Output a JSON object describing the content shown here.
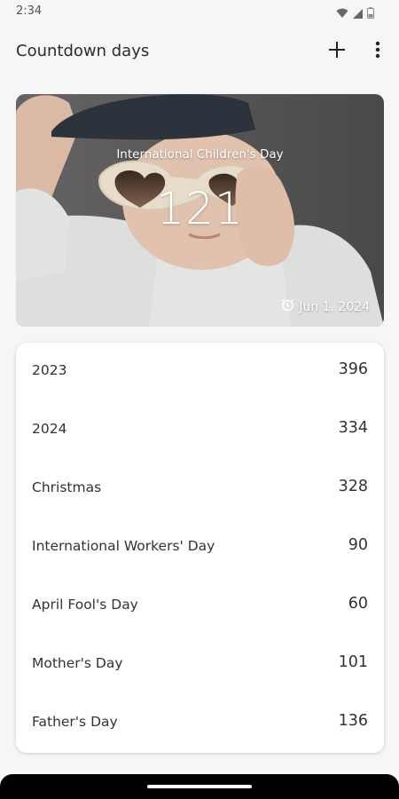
{
  "status_bar": {
    "time": "2:34",
    "icons": [
      "wifi-icon",
      "cellular-signal-icon",
      "battery-icon"
    ]
  },
  "app_bar": {
    "title": "Countdown days",
    "actions": [
      "add-icon",
      "more-vertical-icon"
    ]
  },
  "featured": {
    "name": "International Children's Day",
    "days": "121",
    "date": "Jun 1, 2024",
    "date_icon": "alarm-clock-icon"
  },
  "events": [
    {
      "name": "2023",
      "days": "396"
    },
    {
      "name": "2024",
      "days": "334"
    },
    {
      "name": "Christmas",
      "days": "328"
    },
    {
      "name": "International Workers' Day",
      "days": "90"
    },
    {
      "name": "April Fool's Day",
      "days": "60"
    },
    {
      "name": "Mother's Day",
      "days": "101"
    },
    {
      "name": "Father's Day",
      "days": "136"
    }
  ],
  "colors": {
    "background": "#f6f6f6",
    "card": "#ffffff",
    "text": "#333333",
    "hero_text": "#ffffff"
  }
}
